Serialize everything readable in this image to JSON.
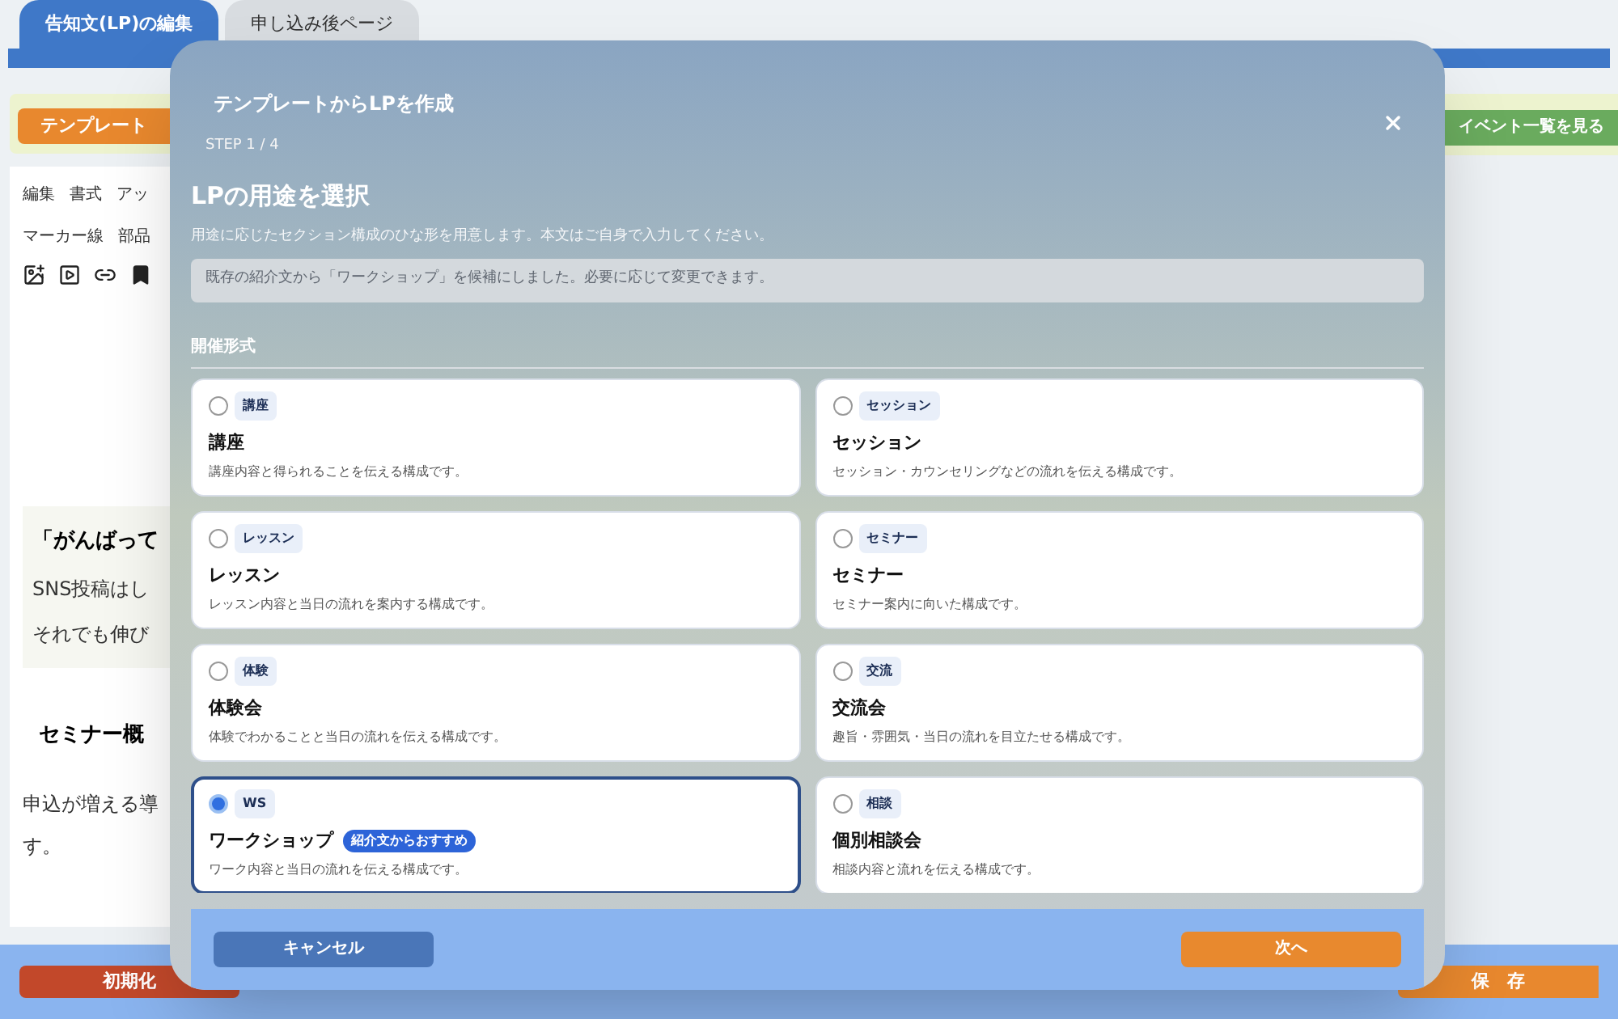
{
  "tabs": [
    {
      "label": "告知文(LP)の編集",
      "selected": true
    },
    {
      "label": "申し込み後ページ",
      "selected": false
    }
  ],
  "top_actions": {
    "template_button": "テンプレート",
    "events_link": "イベント一覧を見る"
  },
  "editor": {
    "menu_rows": [
      [
        "編集",
        "書式",
        "アッ"
      ],
      [
        "マーカー線",
        "部品"
      ]
    ],
    "quote_heading": "「がんばって",
    "quote_lines": [
      "SNS投稿はし",
      "それでも伸び"
    ],
    "section_heading": "セミナー概",
    "body_lines": [
      "申込が増える導",
      "す。"
    ]
  },
  "bottom_bar": {
    "reset_button": "初期化",
    "save_button": "保　存"
  },
  "modal": {
    "title": "テンプレートからLPを作成",
    "step": "STEP 1 / 4",
    "heading": "LPの用途を選択",
    "description": "用途に応じたセクション構成のひな形を用意します。本文はご自身で入力してください。",
    "notice": "既存の紹介文から「ワークショップ」を候補にしました。必要に応じて変更できます。",
    "section_label": "開催形式",
    "options": [
      {
        "tag": "講座",
        "title": "講座",
        "description": "講座内容と得られることを伝える構成です。",
        "selected": false
      },
      {
        "tag": "セッション",
        "title": "セッション",
        "description": "セッション・カウンセリングなどの流れを伝える構成です。",
        "selected": false
      },
      {
        "tag": "レッスン",
        "title": "レッスン",
        "description": "レッスン内容と当日の流れを案内する構成です。",
        "selected": false
      },
      {
        "tag": "セミナー",
        "title": "セミナー",
        "description": "セミナー案内に向いた構成です。",
        "selected": false
      },
      {
        "tag": "体験",
        "title": "体験会",
        "description": "体験でわかることと当日の流れを伝える構成です。",
        "selected": false
      },
      {
        "tag": "交流",
        "title": "交流会",
        "description": "趣旨・雰囲気・当日の流れを目立たせる構成です。",
        "selected": false
      },
      {
        "tag": "WS",
        "title": "ワークショップ",
        "badge": "紹介文からおすすめ",
        "description": "ワーク内容と当日の流れを伝える構成です。",
        "selected": true
      },
      {
        "tag": "相談",
        "title": "個別相談会",
        "description": "相談内容と流れを伝える構成です。",
        "selected": false
      }
    ],
    "cancel_button": "キャンセル",
    "next_button": "次へ"
  }
}
